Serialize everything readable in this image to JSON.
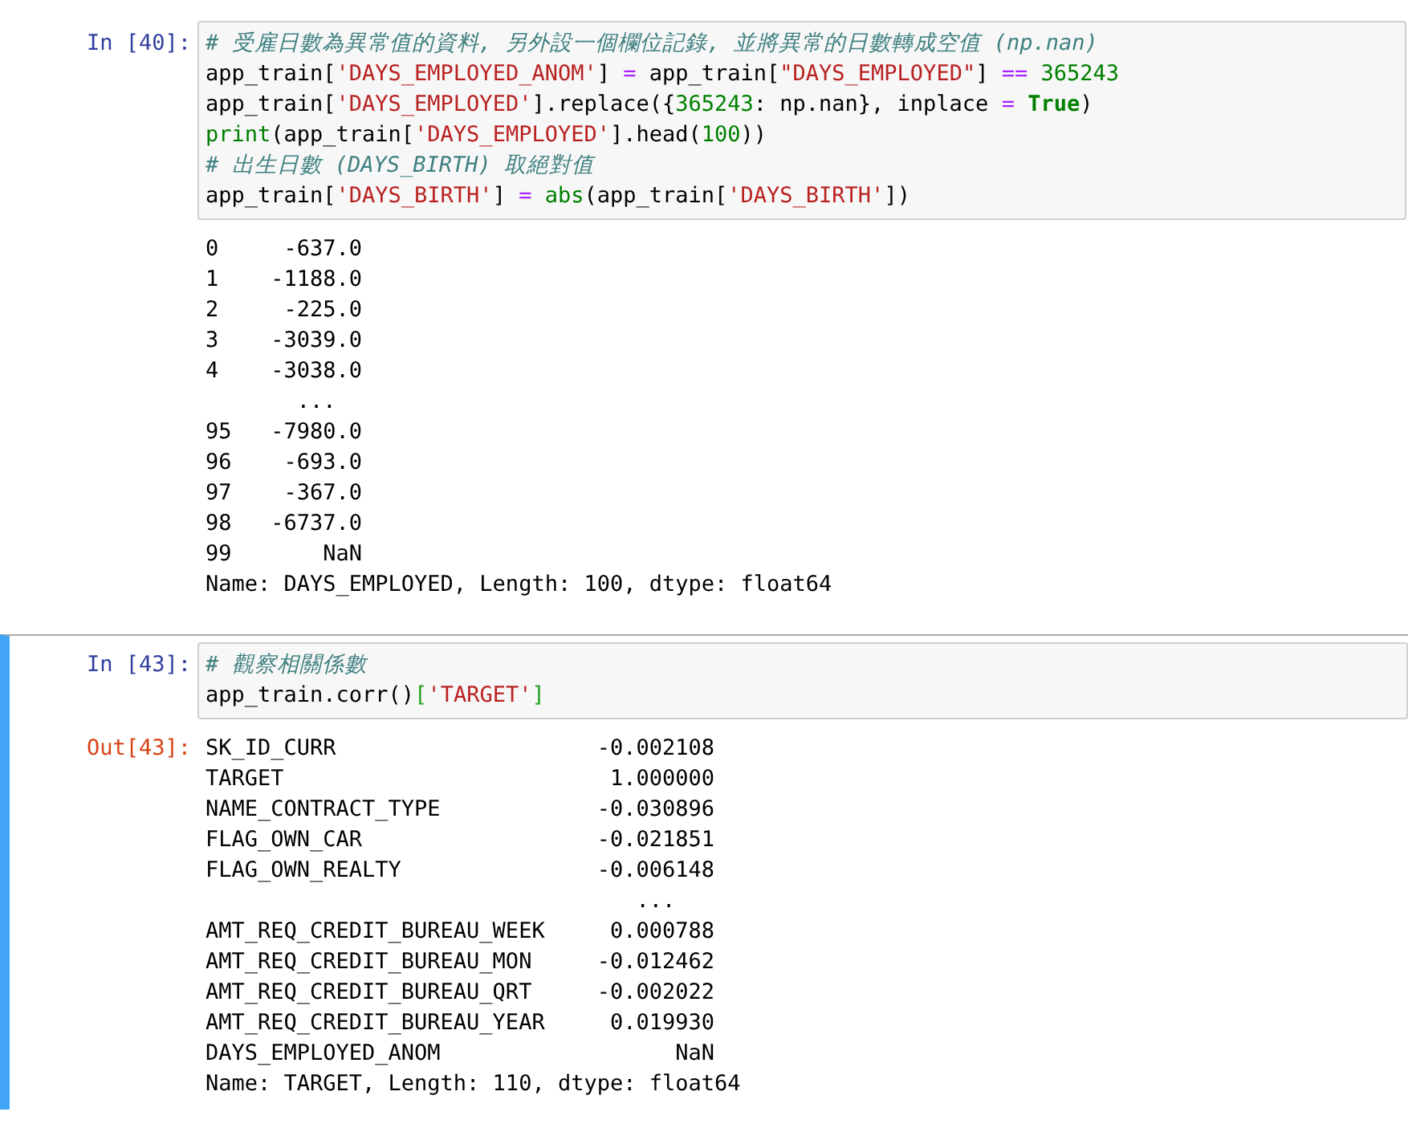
{
  "cells": [
    {
      "selected": false,
      "input_prompt": "In [40]:",
      "code": [
        [
          {
            "kind": "comment",
            "text": "# 受雇日數為異常值的資料, 另外設一個欄位記錄, 並將異常的日數轉成空值 (np.nan)"
          }
        ],
        [
          {
            "kind": "plain",
            "text": "app_train["
          },
          {
            "kind": "string",
            "text": "'DAYS_EMPLOYED_ANOM'"
          },
          {
            "kind": "plain",
            "text": "] "
          },
          {
            "kind": "operator",
            "text": "="
          },
          {
            "kind": "plain",
            "text": " app_train["
          },
          {
            "kind": "string",
            "text": "\"DAYS_EMPLOYED\""
          },
          {
            "kind": "plain",
            "text": "] "
          },
          {
            "kind": "operator",
            "text": "== "
          },
          {
            "kind": "number",
            "text": "365243"
          }
        ],
        [
          {
            "kind": "plain",
            "text": "app_train["
          },
          {
            "kind": "string",
            "text": "'DAYS_EMPLOYED'"
          },
          {
            "kind": "plain",
            "text": "].replace({"
          },
          {
            "kind": "number",
            "text": "365243"
          },
          {
            "kind": "plain",
            "text": ": np.nan}, inplace "
          },
          {
            "kind": "operator",
            "text": "= "
          },
          {
            "kind": "keyword",
            "text": "True"
          },
          {
            "kind": "plain",
            "text": ")"
          }
        ],
        [
          {
            "kind": "builtin",
            "text": "print"
          },
          {
            "kind": "plain",
            "text": "(app_train["
          },
          {
            "kind": "string",
            "text": "'DAYS_EMPLOYED'"
          },
          {
            "kind": "plain",
            "text": "].head("
          },
          {
            "kind": "number",
            "text": "100"
          },
          {
            "kind": "plain",
            "text": "))"
          }
        ],
        [
          {
            "kind": "comment",
            "text": "# 出生日數 (DAYS_BIRTH) 取絕對值"
          }
        ],
        [
          {
            "kind": "plain",
            "text": "app_train["
          },
          {
            "kind": "string",
            "text": "'DAYS_BIRTH'"
          },
          {
            "kind": "plain",
            "text": "] "
          },
          {
            "kind": "operator",
            "text": "= "
          },
          {
            "kind": "builtin",
            "text": "abs"
          },
          {
            "kind": "plain",
            "text": "(app_train["
          },
          {
            "kind": "string",
            "text": "'DAYS_BIRTH'"
          },
          {
            "kind": "plain",
            "text": "])"
          }
        ]
      ],
      "output": [
        "0     -637.0",
        "1    -1188.0",
        "2     -225.0",
        "3    -3039.0",
        "4    -3038.0",
        "       ...",
        "95   -7980.0",
        "96    -693.0",
        "97    -367.0",
        "98   -6737.0",
        "99       NaN",
        "Name: DAYS_EMPLOYED, Length: 100, dtype: float64"
      ]
    },
    {
      "selected": true,
      "input_prompt": "In [43]:",
      "code": [
        [
          {
            "kind": "comment",
            "text": "# 觀察相關係數"
          }
        ],
        [
          {
            "kind": "plain",
            "text": "app_train.corr()"
          },
          {
            "kind": "bracket",
            "text": "["
          },
          {
            "kind": "string",
            "text": "'TARGET'"
          },
          {
            "kind": "bracket",
            "text": "]"
          }
        ]
      ],
      "output_prompt": "Out[43]:",
      "output": [
        "SK_ID_CURR                    -0.002108",
        "TARGET                         1.000000",
        "NAME_CONTRACT_TYPE            -0.030896",
        "FLAG_OWN_CAR                  -0.021851",
        "FLAG_OWN_REALTY               -0.006148",
        "                                 ...",
        "AMT_REQ_CREDIT_BUREAU_WEEK     0.000788",
        "AMT_REQ_CREDIT_BUREAU_MON     -0.012462",
        "AMT_REQ_CREDIT_BUREAU_QRT     -0.002022",
        "AMT_REQ_CREDIT_BUREAU_YEAR     0.019930",
        "DAYS_EMPLOYED_ANOM                  NaN",
        "Name: TARGET, Length: 110, dtype: float64"
      ]
    }
  ]
}
